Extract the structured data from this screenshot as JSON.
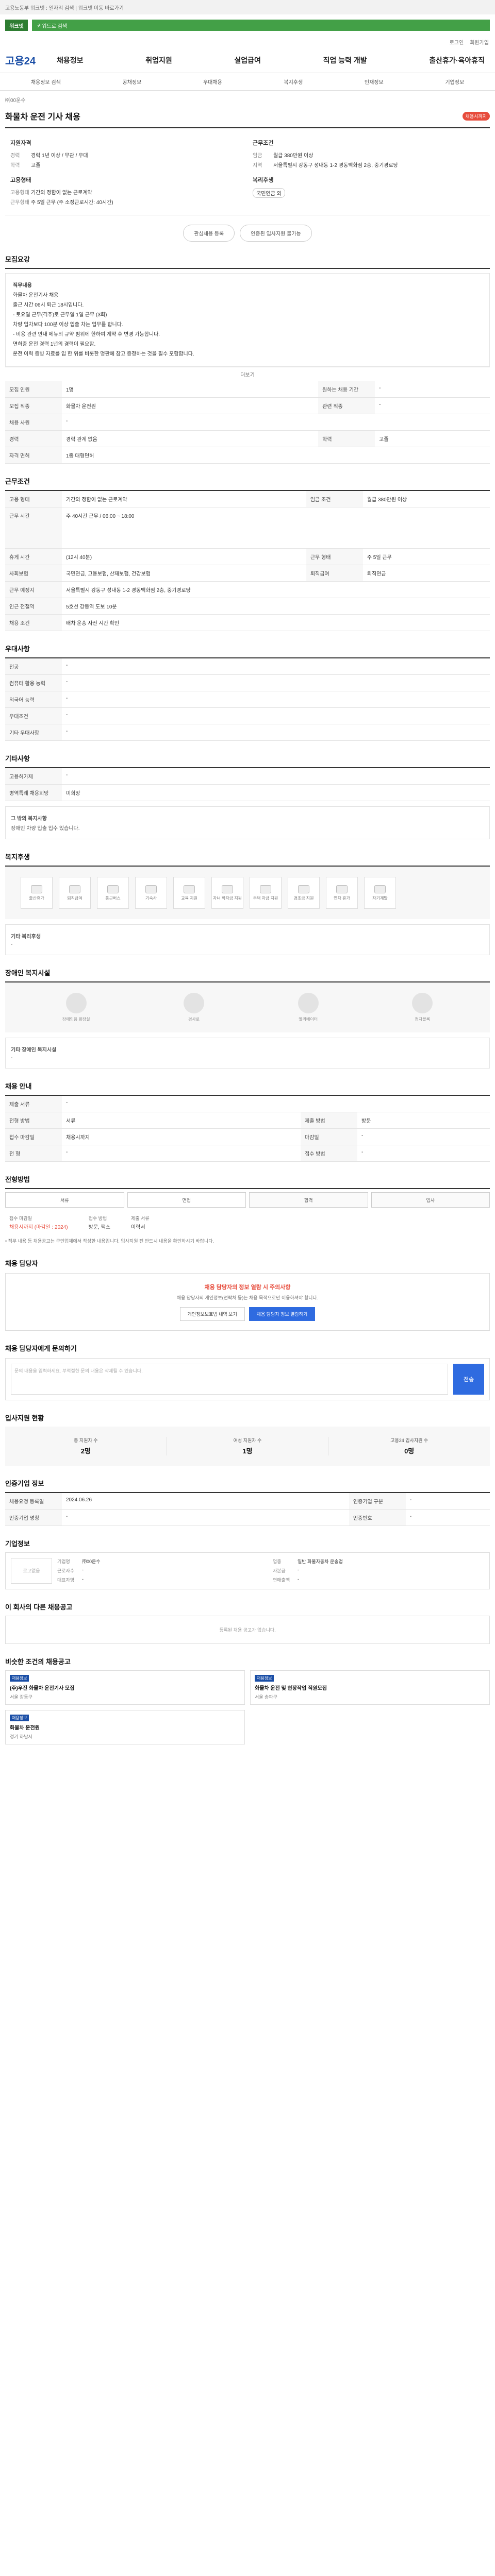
{
  "topbar": {
    "text": "고용노동부 워크넷 : 일자리 검색 | 워크넷 이동 바로가기"
  },
  "search": {
    "brand": "워크넷",
    "placeholder": "키워드로 검색"
  },
  "util": [
    "로그인",
    "회원가입"
  ],
  "logo": "고용24",
  "menu": [
    "채용정보",
    "취업지원",
    "실업급여",
    "직업 능력 개발",
    "출산휴가·육아휴직"
  ],
  "lnb": [
    "채용정보 검색",
    "공채정보",
    "우대채용",
    "복지후생",
    "인재정보",
    "기업정보"
  ],
  "job": {
    "title": "화물차 운전 기사 채용",
    "deadline_badge": "채용시까지",
    "company": "㈜00운수",
    "left_title": "지원자격",
    "left": [
      {
        "k": "경력",
        "v": "경력 1년 이상 / 무관 / 우대"
      },
      {
        "k": "학력",
        "v": "고졸"
      }
    ],
    "right_title": "근무조건",
    "right": [
      {
        "k": "임금",
        "v": "월급 380만원 이상"
      },
      {
        "k": "지역",
        "v": "서울특별시 강동구 성내동 1-2 경동백화점 2층, 중기경로당"
      }
    ],
    "left2_title": "고용형태",
    "left2": [
      {
        "k": "고용형태",
        "v": "기간의 정함이 없는 근로계약"
      },
      {
        "k": "근무형태",
        "v": "주 5일 근무 (주 소정근로시간: 40시간)"
      }
    ],
    "right2_title": "복리후생",
    "right2": [
      {
        "k": "",
        "v": "국민연금 외"
      }
    ]
  },
  "actions": {
    "scrap": "관심채용 등록",
    "apply": "인증된 입사지원 불가능"
  },
  "sections": {
    "recruit": "모집요강",
    "conditions": "근무조건",
    "apply_method": "전형방법",
    "contact": "채용 담당자",
    "inquiry": "채용 담당자에게 문의하기",
    "applicants": "입사지원 현황",
    "company_info": "기업정보",
    "similar": "비슷한 조건의 채용공고",
    "near": "이 회사의 다른 채용공고",
    "welfare": "복지후생",
    "disability": "장애인 복지시설",
    "preference": "우대사항",
    "language": "기타사항",
    "manager": "인증기업 정보",
    "pay_dtl": "채용 안내"
  },
  "recruit_desc": {
    "title": "직무내용",
    "lines": [
      "화물차 운전기사 채용",
      "",
      "출근 시간 06시 퇴근 18시입니다.",
      "- 토요일 근무(격주)로 근무일 1일 근무 (3회)",
      "차량 입차보다 100분 이상 입출 차는 업무를 합니다.",
      "- 비용 관련 안내 메뉴의 규약 범위에 한하여 계약 후 변경 가능합니다.",
      "면허증 운전 경력 1년의 경력이 필요함.",
      "",
      "운전 이력 증빙 자료를 입 한 위를 비롯한 명판에 참고 증정하는 것을 필수 포함합니다.",
      "면허 소지 분 우대",
      "운전 이력 증빙 자료를 입 한 위를 비롯한 명판에 참고 증정하는 것을 필수 포함합니다."
    ],
    "more": "더보기"
  },
  "recruit_table": [
    [
      "모집 인원",
      "1명",
      "원하는 채용 기간",
      "-"
    ],
    [
      "모집 직종",
      "화물차 운전원",
      "관련 직종",
      "-"
    ],
    [
      "채용 사원",
      "-",
      "",
      ""
    ],
    [
      "경력",
      "경력 관계 없음",
      "학력",
      "고졸"
    ],
    [
      "자격 면허",
      "1종 대형면허",
      "",
      ""
    ]
  ],
  "conditions_table": [
    [
      "고용 형태",
      "기간의 정함이 없는 근로계약",
      "임금 조건",
      "월급 380만원 이상"
    ],
    [
      "근무 시간",
      "주 40시간 근무 / 06:00 ~ 18:00",
      "",
      ""
    ],
    [
      "휴게 시간",
      "(12시 40분)",
      "근무 형태",
      "주 5일 근무"
    ],
    [
      "사회보험",
      "국민연금, 고용보험, 산재보험, 건강보험",
      "퇴직급여",
      "퇴직연금"
    ],
    [
      "근무 예정지",
      "서울특별시 강동구 성내동 1-2 경동백화점 2층, 중기경로당",
      "",
      ""
    ],
    [
      "인근 전철역",
      "5호선 강동역 도보 10분",
      "",
      ""
    ],
    [
      "채용 조건",
      "배차 운송 사전 시간 확인",
      "",
      ""
    ]
  ],
  "preference_table": [
    [
      "전공",
      "-"
    ],
    [
      "컴퓨터 활용 능력",
      "-"
    ],
    [
      "외국어 능력",
      "-"
    ],
    [
      "우대조건",
      "-"
    ],
    [
      "기타 우대사항",
      "-"
    ]
  ],
  "language_table": [
    [
      "고용허가제",
      "-"
    ],
    [
      "병역특례 채용희망",
      "미희망"
    ]
  ],
  "language_note": {
    "title": "그 밖의 복지사항",
    "text": "장애인 차량 입출 입수 있습니다."
  },
  "welfare_items": [
    "출산휴가",
    "퇴직급여",
    "통근버스",
    "기숙사",
    "교육 지원",
    "자녀 학자금 지원",
    "주택 자금 지원",
    "경조금 지원",
    "연차 휴가",
    "자기계발"
  ],
  "welfare_note": {
    "title": "기타 복리후생",
    "text": "-"
  },
  "disability_items": [
    "장애인용 화장실",
    "경사로",
    "엘리베이터",
    "점자블록"
  ],
  "disability_note": {
    "title": "기타 장애인 복지시설",
    "text": "-"
  },
  "apply_table": [
    [
      "제출 서류",
      "-",
      "",
      ""
    ],
    [
      "전형 방법",
      "서류",
      "제출 방법",
      "방문"
    ],
    [
      "접수 마감일",
      "채용시까지",
      "마감일",
      "-"
    ],
    [
      "전 형",
      "-",
      "접수 방법",
      "-"
    ]
  ],
  "steps": [
    "서류",
    "면접",
    "합격",
    "입사"
  ],
  "apply_info": [
    {
      "k": "접수 마감일",
      "v": "채용시까지 (마감일 : 2024)"
    },
    {
      "k": "접수 방법",
      "v": "방문, 팩스"
    },
    {
      "k": "제출 서류",
      "v": "이력서"
    }
  ],
  "small_notes": "• 직무 내용 등 채용공고는 구인업체에서 작성한 내용입니다. 입사지원 전 반드시 내용을 확인하시기 바랍니다.",
  "contact_alert": {
    "title": "채용 담당자의 정보 열람 시 주의사항",
    "text": "채용 담당자의 개인정보(연락처 등)는 채용 목적으로만 이용하셔야 합니다.",
    "btn1": "개인정보보호법 내역 보기",
    "btn2": "채용 담당자 정보 열람하기"
  },
  "inquiry": {
    "placeholder": "문의 내용을 입력하세요. 부적절한 문의 내용은 삭제될 수 있습니다.",
    "send": "전송"
  },
  "applicants": [
    {
      "l": "총 지원자 수",
      "n": "2명"
    },
    {
      "l": "여성 지원자 수",
      "n": "1명"
    },
    {
      "l": "고용24 입사지원 수",
      "n": "0명"
    }
  ],
  "manager_table": [
    [
      "채용요청 등록일",
      "2024.06.26",
      "인증기업 구분",
      "-"
    ],
    [
      "인증기업 명칭",
      "-",
      "인증번호",
      "-"
    ]
  ],
  "company": {
    "logo_alt": "로고없음",
    "fields": [
      {
        "k": "기업명",
        "v": "㈜00운수"
      },
      {
        "k": "업종",
        "v": "일반 화물자동차 운송업"
      },
      {
        "k": "근로자수",
        "v": "-"
      },
      {
        "k": "자본금",
        "v": "-"
      },
      {
        "k": "대표자명",
        "v": "-"
      },
      {
        "k": "연매출액",
        "v": "-"
      }
    ]
  },
  "near_empty": "등록된 채용 공고가 없습니다.",
  "similar_cards": [
    {
      "badge": "채용정보",
      "title": "(주)우진 화물차 운전기사 모집",
      "loc": "서울 강동구"
    },
    {
      "badge": "채용정보",
      "title": "화물차 운전 및 현장작업 직원모집",
      "loc": "서울 송파구"
    },
    {
      "badge": "채용정보",
      "title": "화물차 운전원",
      "loc": "경기 하남시"
    }
  ]
}
